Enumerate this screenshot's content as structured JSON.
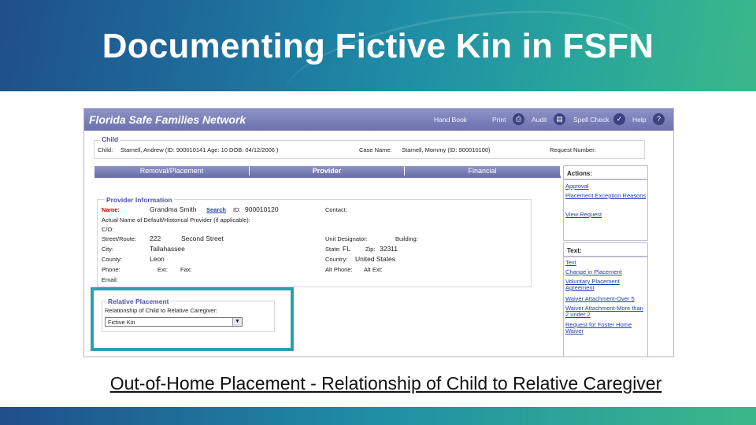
{
  "slide": {
    "title": "Documenting Fictive Kin in FSFN",
    "caption": "Out-of-Home Placement - Relationship of Child to Relative Caregiver"
  },
  "app": {
    "title": "Florida Safe Families Network",
    "toolbar": {
      "handbook": "Hand Book",
      "print": "Print",
      "audit": "Audit",
      "spellcheck": "Spell Check",
      "help": "Help"
    },
    "child": {
      "group_title": "Child",
      "child_label": "Child:",
      "child_value": "Starnell, Andrew (ID: 900010141 Age: 10 DOB: 04/12/2006 )",
      "case_label": "Case Name:",
      "case_value": "Starnell, Mommy (ID: 900010100)",
      "request_label": "Request Number:"
    },
    "tabs": [
      "Removal/Placement",
      "Provider",
      "Financial"
    ],
    "provider": {
      "group_title": "Provider Information",
      "name_label": "Name:",
      "name_value": "Grandma Smith",
      "search_label": "Search",
      "id_label": "ID:",
      "id_value": "900010120",
      "contact_label": "Contact:",
      "actual_name_label": "Actual Name of Default/Historical Provider (if applicable):",
      "co_label": "C/O:",
      "street_label": "Street/Route:",
      "street_num": "222",
      "street_name": "Second Street",
      "unit_label": "Unit Designator:",
      "building_label": "Building:",
      "city_label": "City:",
      "city_value": "Tallahassee",
      "state_label": "State:",
      "state_value": "FL",
      "zip_label": "Zip:",
      "zip_value": "32311",
      "county_label": "County:",
      "county_value": "Leon",
      "country_label": "Country:",
      "country_value": "United States",
      "phone_label": "Phone:",
      "ext_label": "Ext:",
      "fax_label": "Fax:",
      "altphone_label": "Alt Phone:",
      "altext_label": "Alt Ext:",
      "email_label": "Email:"
    },
    "relative": {
      "group_title": "Relative Placement",
      "relationship_label": "Relationship of Child to Relative Caregiver:",
      "relationship_value": "Fictive Kin"
    },
    "actions": {
      "header": "Actions:",
      "links": [
        "Approval",
        "Placement Exception Reasons",
        "View Request"
      ]
    },
    "text_panel": {
      "header": "Text:",
      "links": [
        "Text",
        "Change in Placement",
        "Voluntary Placement Agreement",
        "Waiver Attachment-Over 5",
        "Waiver Attachment-More than 2 under 2",
        "Request for Foster Home Waiver"
      ]
    },
    "colors": {
      "accent": "#6d72ab",
      "highlight": "#2aa0b0",
      "required": "#cc0000"
    }
  }
}
